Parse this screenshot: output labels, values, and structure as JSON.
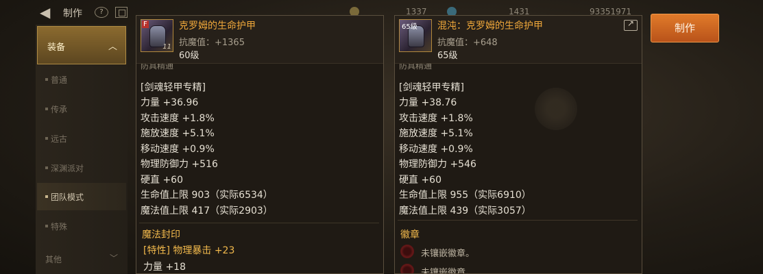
{
  "topbar": {
    "title": "制作",
    "resource_1": "1337",
    "resource_2": "1431",
    "resource_3": "93351971"
  },
  "sidebar": {
    "header": "装备",
    "items": [
      {
        "label": "普通",
        "active": false
      },
      {
        "label": "传承",
        "active": false
      },
      {
        "label": "远古",
        "active": false
      },
      {
        "label": "深渊派对",
        "active": false
      },
      {
        "label": "团队模式",
        "active": true
      },
      {
        "label": "特殊",
        "active": false
      }
    ],
    "other": "其他"
  },
  "cards": [
    {
      "icon_tag": "F",
      "enhance": "11",
      "name": "克罗姆的生命护甲",
      "resist": "抗魔值：+1365",
      "level": "60级",
      "cut_label": "防具精通",
      "stats": [
        "[剑魂轻甲专精]",
        "力量 +36.96",
        "攻击速度 +1.8%",
        "施放速度 +5.1%",
        "移动速度 +0.9%",
        "物理防御力 +516",
        "硬直 +60",
        "生命值上限 903（实际6534）",
        "魔法值上限 417（实际2903）"
      ],
      "section_title": "魔法封印",
      "seal_line": "[特性] 物理暴击 +23",
      "seal_extra": "力量 +18"
    },
    {
      "icon_tag": "65级",
      "name": "混沌：克罗姆的生命护甲",
      "resist": "抗魔值：+648",
      "level": "65级",
      "cut_label": "防具精通",
      "stats": [
        "[剑魂轻甲专精]",
        "力量 +38.76",
        "攻击速度 +1.8%",
        "施放速度 +5.1%",
        "移动速度 +0.9%",
        "物理防御力 +546",
        "硬直 +60",
        "生命值上限 955（实际6910）",
        "魔法值上限 439（实际3057）"
      ],
      "section_title": "徽章",
      "emblems": [
        "未镶嵌徽章。",
        "未镶嵌徽章。"
      ]
    }
  ],
  "make_button": "制作",
  "colors": {
    "item_name": "#f0a83a",
    "section_title": "#f2b94c",
    "make_button": "#d06a24",
    "sidebar_active": "#8b6a2f"
  }
}
